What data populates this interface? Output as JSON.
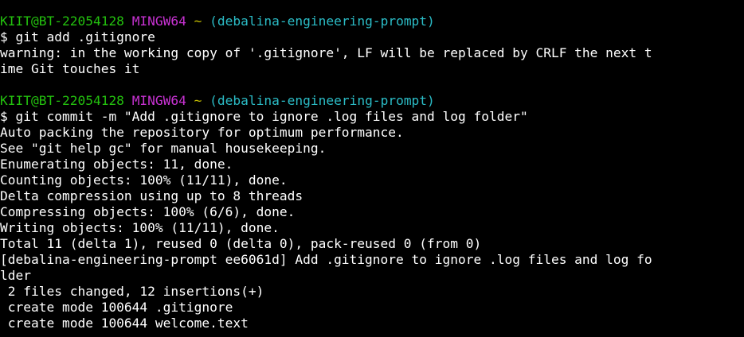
{
  "terminal": {
    "colors": {
      "background": "#000000",
      "text": "#ffffff",
      "user_host": "#23c10e",
      "shell": "#c832d3",
      "directory": "#c7c000",
      "branch": "#2bbcc6"
    },
    "prompt1": {
      "user_host": "KIIT@BT-22054128",
      "shell": "MINGW64",
      "directory": "~",
      "branch": "(debalina-engineering-prompt)"
    },
    "cmd1": "$ git add .gitignore",
    "out1": [
      "warning: in the working copy of '.gitignore', LF will be replaced by CRLF the next t",
      "ime Git touches it"
    ],
    "prompt2": {
      "user_host": "KIIT@BT-22054128",
      "shell": "MINGW64",
      "directory": "~",
      "branch": "(debalina-engineering-prompt)"
    },
    "cmd2": "$ git commit -m \"Add .gitignore to ignore .log files and log folder\"",
    "out2": [
      "Auto packing the repository for optimum performance.",
      "See \"git help gc\" for manual housekeeping.",
      "Enumerating objects: 11, done.",
      "Counting objects: 100% (11/11), done.",
      "Delta compression using up to 8 threads",
      "Compressing objects: 100% (6/6), done.",
      "Writing objects: 100% (11/11), done.",
      "Total 11 (delta 1), reused 0 (delta 0), pack-reused 0 (from 0)",
      "[debalina-engineering-prompt ee6061d] Add .gitignore to ignore .log files and log fo",
      "lder",
      " 2 files changed, 12 insertions(+)",
      " create mode 100644 .gitignore",
      " create mode 100644 welcome.text"
    ]
  }
}
